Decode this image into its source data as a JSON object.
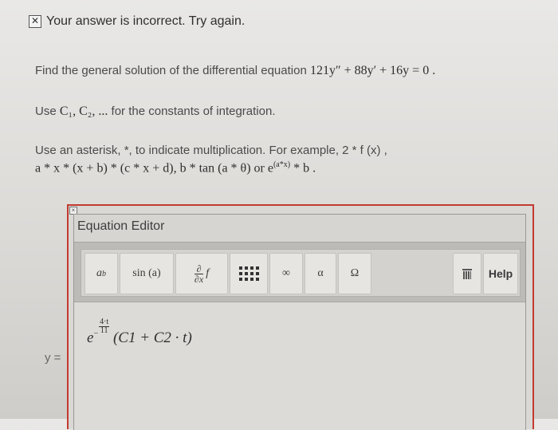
{
  "feedback": {
    "icon": "close-x-icon",
    "text": "Your answer is incorrect.  Try again."
  },
  "problem": {
    "prompt": "Find the general solution of the differential equation",
    "equation": "121y″ + 88y′ + 16y = 0 .",
    "constants_prefix": "Use",
    "constants": "C₁, C₂, ...",
    "constants_suffix": "for the constants of integration.",
    "asterisk_note": "Use an asterisk, *, to indicate multiplication. For example, 2 * f (x) ,",
    "example_line": "a * x * (x + b) * (c * x + d),   b * tan (a * θ)   or e",
    "example_exp": "(a*x)",
    "example_tail": "* b ."
  },
  "editor": {
    "title": "Equation Editor",
    "buttons": {
      "power_base": "a",
      "power_exp": "b",
      "sin": "sin (a)",
      "partial_num": "∂",
      "partial_den": "∂x",
      "partial_f": "f",
      "matrix_icon": "matrix-icon",
      "infinity": "∞",
      "alpha": "α",
      "omega": "Ω",
      "trash_icon": "trash-icon",
      "help": "Help"
    },
    "answer": {
      "base": "e",
      "exp_minus": "−",
      "exp_num": "4·t",
      "exp_den": "11",
      "body": "(C1 + C2 · t)"
    }
  },
  "y_label": "y ="
}
